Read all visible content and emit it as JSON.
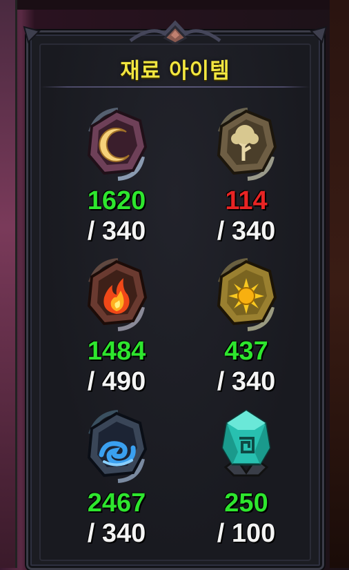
{
  "title": "재료 아이템",
  "colors": {
    "enough": "#2ee62e",
    "lacking": "#e82424",
    "title": "#f2e640"
  },
  "items": [
    {
      "icon": "moon-stone-icon",
      "have": "1620",
      "need": "/ 340",
      "status": "enough"
    },
    {
      "icon": "tree-stone-icon",
      "have": "114",
      "need": "/ 340",
      "status": "lacking"
    },
    {
      "icon": "fire-stone-icon",
      "have": "1484",
      "need": "/ 490",
      "status": "enough"
    },
    {
      "icon": "sun-stone-icon",
      "have": "437",
      "need": "/ 340",
      "status": "enough"
    },
    {
      "icon": "water-stone-icon",
      "have": "2467",
      "need": "/ 340",
      "status": "enough"
    },
    {
      "icon": "rune-crystal-icon",
      "have": "250",
      "need": "/ 100",
      "status": "enough"
    }
  ]
}
